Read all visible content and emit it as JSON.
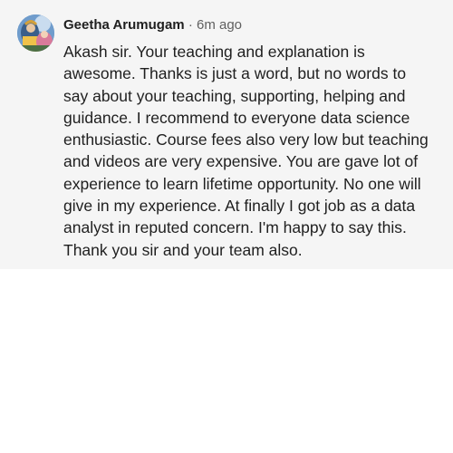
{
  "comment": {
    "author": "Geetha Arumugam",
    "separator": "·",
    "time": "6m ago",
    "avatar_icon": "profile-avatar-icon",
    "text": "Akash sir. Your teaching and explanation is awesome. Thanks is just a word, but no words to say about your teaching, supporting, helping and guidance. I recommend to everyone data science enthusiastic. Course fees also very low but teaching and videos are very expensive. You are gave lot of experience to learn lifetime opportunity. No one will give in my experience. At finally I got job as a data analyst in reputed concern. I'm happy to say this. Thank you sir and your team also."
  },
  "colors": {
    "card_background": "#f5f5f5",
    "page_background": "#ffffff",
    "author_text": "#1f1f1f",
    "meta_text": "#606060",
    "body_text": "#1f1f1f"
  }
}
